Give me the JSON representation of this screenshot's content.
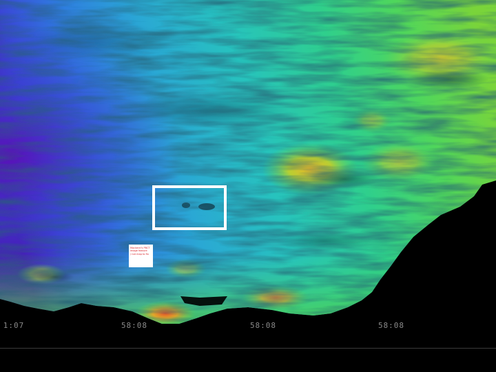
{
  "map": {
    "type": "shaded bathymetry relief",
    "colormap": [
      "#4a14b0",
      "#2f5fe0",
      "#2aa6d8",
      "#25c9b8",
      "#35d07a",
      "#9ad43a",
      "#e0b22a",
      "#e0552a"
    ],
    "background": "#000000",
    "highlight_color": "#ffffff"
  },
  "label_card": {
    "lines": [
      "Mackerel's PBCT",
      "image feature",
      "/ not map to fix"
    ],
    "text_color": "#d9262a"
  },
  "axis": {
    "ticks": [
      "1:07",
      "58:08",
      "58:08",
      "58:08"
    ]
  }
}
